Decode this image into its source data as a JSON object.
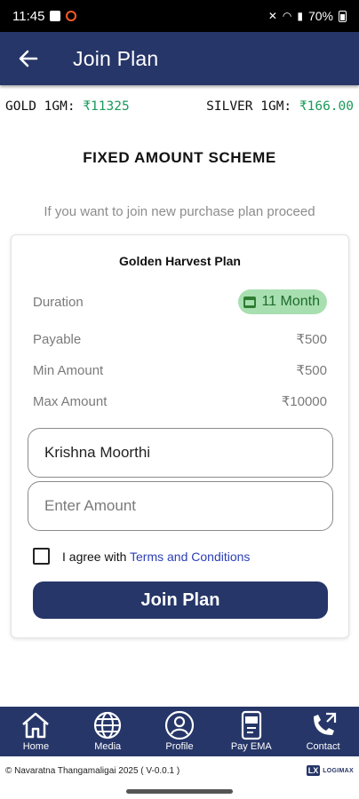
{
  "status_bar": {
    "time": "11:45",
    "battery": "70%"
  },
  "app_bar": {
    "title": "Join Plan"
  },
  "rates": {
    "gold_label": "GOLD 1GM:",
    "gold_value": "₹11325",
    "silver_label": "SILVER 1GM:",
    "silver_value": "₹166.00"
  },
  "scheme_title": "FIXED AMOUNT SCHEME",
  "hint": "If you want to join new purchase plan proceed",
  "plan": {
    "name": "Golden Harvest Plan",
    "duration_label": "Duration",
    "duration_value": "11  Month",
    "payable_label": "Payable",
    "payable_value": "₹500",
    "min_label": "Min Amount",
    "min_value": "₹500",
    "max_label": "Max Amount",
    "max_value": "₹10000"
  },
  "form": {
    "name_value": "Krishna Moorthi",
    "amount_placeholder": "Enter Amount",
    "agree_text": "I agree with",
    "terms_link": "Terms and Conditions",
    "submit_label": "Join Plan"
  },
  "nav": [
    {
      "label": "Home",
      "icon": "home-icon"
    },
    {
      "label": "Media",
      "icon": "globe-icon"
    },
    {
      "label": "Profile",
      "icon": "person-icon"
    },
    {
      "label": "Pay EMA",
      "icon": "pay-icon"
    },
    {
      "label": "Contact",
      "icon": "phone-icon"
    }
  ],
  "footer": {
    "copyright": "© Navaratna Thangamaligai 2025 ( V-0.0.1 )",
    "logo_mark": "LX",
    "logo_text": "LOGIMAX"
  },
  "colors": {
    "primary": "#263668",
    "accent_green": "#1a9a5a",
    "chip": "#a8dfb0",
    "link": "#2b3fb5"
  }
}
